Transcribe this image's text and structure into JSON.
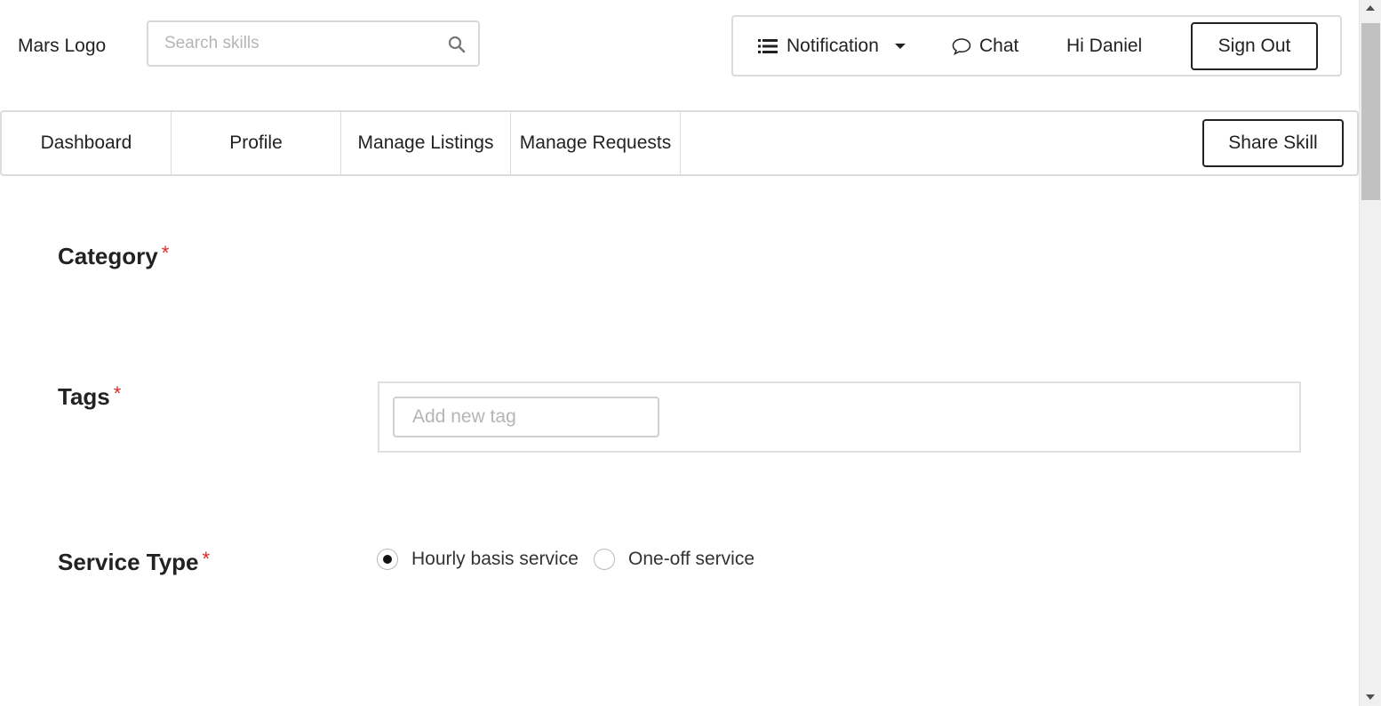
{
  "header": {
    "logo": "Mars Logo",
    "search_placeholder": "Search skills",
    "search_icon": "search-icon"
  },
  "topmenu": {
    "notification_label": "Notification",
    "notification_icon": "list-icon",
    "chat_label": "Chat",
    "chat_icon": "chat-bubble-icon",
    "greeting": "Hi Daniel",
    "signout_label": "Sign Out"
  },
  "nav": {
    "tabs": [
      {
        "label": "Dashboard"
      },
      {
        "label": "Profile"
      },
      {
        "label": "Manage Listings"
      },
      {
        "label": "Manage Requests"
      }
    ],
    "share_label": "Share Skill"
  },
  "form": {
    "category": {
      "label": "Category",
      "required_mark": "*"
    },
    "tags": {
      "label": "Tags",
      "required_mark": "*",
      "input_placeholder": "Add new tag"
    },
    "service_type": {
      "label": "Service Type",
      "required_mark": "*",
      "options": [
        {
          "label": "Hourly basis service",
          "checked": true
        },
        {
          "label": "One-off service",
          "checked": false
        }
      ]
    }
  },
  "colors": {
    "required": "#db2828",
    "border": "#dcdcdc",
    "text": "#222222"
  }
}
